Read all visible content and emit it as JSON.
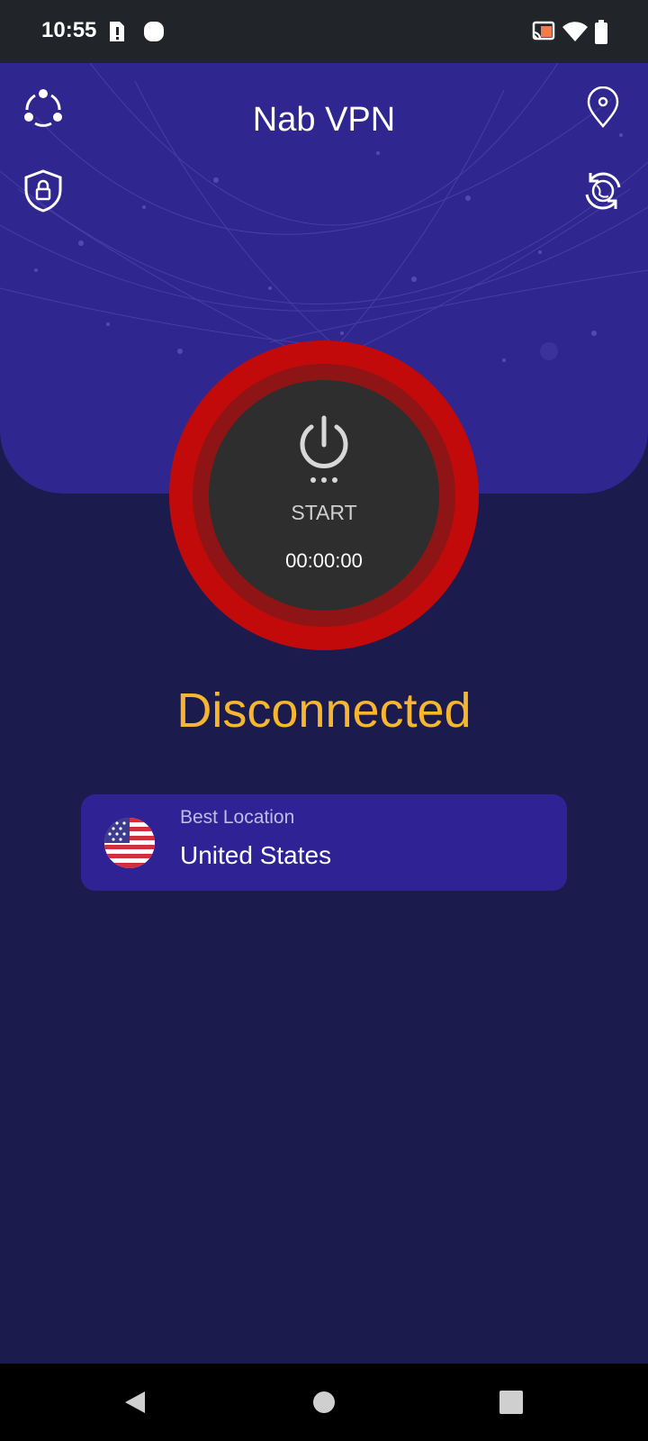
{
  "status_bar": {
    "time": "10:55",
    "icons": [
      "sim-alert-icon",
      "notification-dot-icon",
      "cast-icon",
      "wifi-icon",
      "battery-icon"
    ]
  },
  "header": {
    "title": "Nab VPN",
    "icons": {
      "share": "share-icon",
      "location": "location-pin-icon",
      "shield": "shield-lock-icon",
      "refresh": "refresh-globe-icon"
    }
  },
  "power": {
    "label": "START",
    "timer": "00:00:00"
  },
  "connection": {
    "status": "Disconnected"
  },
  "location": {
    "label": "Best Location",
    "country": "United States",
    "flag": "us-flag-icon"
  },
  "nav": [
    "back-icon",
    "home-icon",
    "recents-icon"
  ],
  "colors": {
    "background": "#1c1b4e",
    "header": "#2f2690",
    "power_ring": "#c30a0a",
    "status": "#f6b62e"
  }
}
